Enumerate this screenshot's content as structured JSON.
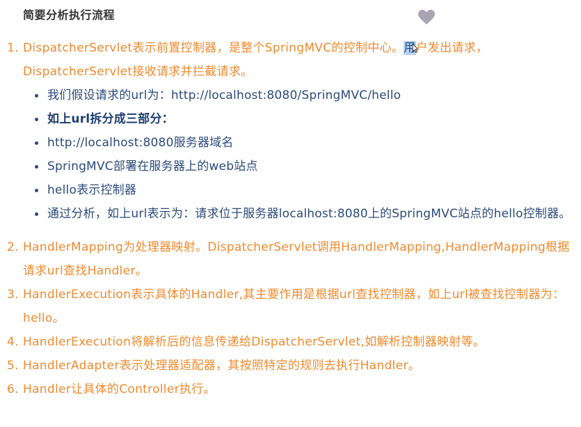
{
  "heading": "简要分析执行流程",
  "steps": [
    {
      "num": "1.",
      "text_before": "DispatcherServlet表示前置控制器，是整个SpringMVC的控制中心。",
      "text_highlight": "用",
      "text_after": "户发出请求，DispatcherServlet接收请求并拦截请求。",
      "subitems": [
        "我们假设请求的url为：http://localhost:8080/SpringMVC/hello",
        "如上url拆分成三部分：",
        "http://localhost:8080服务器域名",
        "SpringMVC部署在服务器上的web站点",
        "hello表示控制器",
        "通过分析，如上url表示为：请求位于服务器localhost:8080上的SpringMVC站点的hello控制器。"
      ]
    },
    {
      "num": "2.",
      "text": "HandlerMapping为处理器映射。DispatcherServlet调用HandlerMapping,HandlerMapping根据请求url查找Handler。"
    },
    {
      "num": "3.",
      "text": "HandlerExecution表示具体的Handler,其主要作用是根据url查找控制器，如上url被查找控制器为：hello。"
    },
    {
      "num": "4.",
      "text": "HandlerExecution将解析后的信息传递给DispatcherServlet,如解析控制器映射等。"
    },
    {
      "num": "5.",
      "text": "HandlerAdapter表示处理器适配器，其按照特定的规则去执行Handler。"
    },
    {
      "num": "6.",
      "text": "Handler让具体的Controller执行。"
    }
  ],
  "colors": {
    "step": "#f08a2e",
    "sub": "#2a4a7a",
    "heart": "#a9a4b3"
  },
  "icons": {
    "favorite": "heart-icon",
    "cursor": "mouse-cursor-icon"
  }
}
